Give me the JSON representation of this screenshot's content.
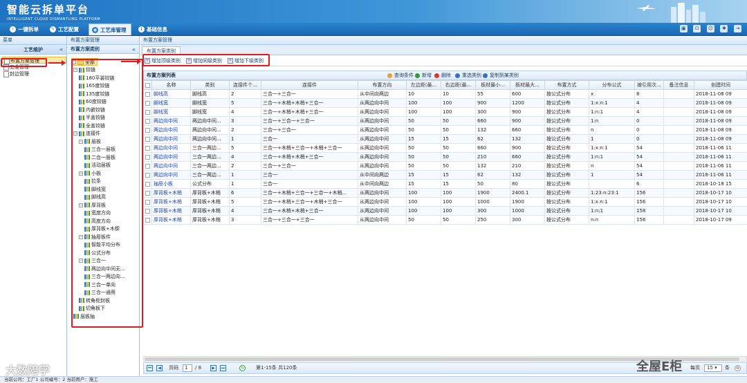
{
  "header": {
    "logo_cn": "智能云拆单平台",
    "logo_en": "INTELLIGENT CLOUD DISMANTLING PLATFORM"
  },
  "nav": {
    "tabs": [
      {
        "label": "一键拆单",
        "icon": "lightning-icon"
      },
      {
        "label": "工艺配置",
        "icon": "wrench-icon"
      },
      {
        "label": "工艺库管理",
        "icon": "library-icon",
        "active": true
      },
      {
        "label": "基础信息",
        "icon": "info-icon"
      }
    ],
    "tools": [
      "print-icon",
      "lock-icon",
      "user-icon",
      "gear-icon",
      "exit-icon"
    ]
  },
  "left": {
    "title": "菜单",
    "subtitle": "工艺维护",
    "items": [
      "布置方案管理",
      "五金管理",
      "封边管理"
    ]
  },
  "mid": {
    "crumb": "布置方案管理",
    "title": "布置方案类别"
  },
  "tree": {
    "root": "全部",
    "nodes": [
      {
        "label": "铰链",
        "level": 1,
        "type": "folder"
      },
      {
        "label": "180平装铰链",
        "level": 2,
        "type": "file"
      },
      {
        "label": "165度铰链",
        "level": 2,
        "type": "file"
      },
      {
        "label": "135度铰链",
        "level": 2,
        "type": "file"
      },
      {
        "label": "60度铰链",
        "level": 2,
        "type": "file"
      },
      {
        "label": "内嵌铰链",
        "level": 2,
        "type": "file"
      },
      {
        "label": "半盖铰链",
        "level": 2,
        "type": "file"
      },
      {
        "label": "全盖铰链",
        "level": 2,
        "type": "file"
      },
      {
        "label": "连接件",
        "level": 1,
        "type": "folder"
      },
      {
        "label": "层板",
        "level": 2,
        "type": "folder"
      },
      {
        "label": "三合一层板",
        "level": 3,
        "type": "file"
      },
      {
        "label": "二合一层板",
        "level": 3,
        "type": "file"
      },
      {
        "label": "活动层板",
        "level": 3,
        "type": "file"
      },
      {
        "label": "小板",
        "level": 2,
        "type": "folder"
      },
      {
        "label": "拉条",
        "level": 3,
        "type": "file"
      },
      {
        "label": "脚线宽",
        "level": 3,
        "type": "file"
      },
      {
        "label": "脚线高",
        "level": 3,
        "type": "file"
      },
      {
        "label": "厚背板",
        "level": 2,
        "type": "folder"
      },
      {
        "label": "宽度方向",
        "level": 3,
        "type": "file"
      },
      {
        "label": "高度方向",
        "level": 3,
        "type": "file"
      },
      {
        "label": "厚背板+木楔",
        "level": 3,
        "type": "file"
      },
      {
        "label": "抽屉板件",
        "level": 2,
        "type": "folder"
      },
      {
        "label": "智能平均分布",
        "level": 3,
        "type": "file"
      },
      {
        "label": "公式分布",
        "level": 3,
        "type": "file"
      },
      {
        "label": "三合一",
        "level": 2,
        "type": "folder"
      },
      {
        "label": "两边向中间无...",
        "level": 3,
        "type": "file"
      },
      {
        "label": "三合一两边向...",
        "level": 3,
        "type": "file"
      },
      {
        "label": "三合一单向",
        "level": 3,
        "type": "file"
      },
      {
        "label": "三合一通用",
        "level": 3,
        "type": "file"
      },
      {
        "label": "转角柜封板",
        "level": 2,
        "type": "file"
      },
      {
        "label": "切角板下",
        "level": 2,
        "type": "file"
      },
      {
        "label": "层板抽",
        "level": 1,
        "type": "file"
      }
    ]
  },
  "main": {
    "crumb": "布置方案管理",
    "tab": "布置方案类别",
    "toolbar": [
      "增加顶级类别",
      "增加同级类别",
      "增加下级类别"
    ],
    "grid_title": "布置方案列表",
    "grid_buttons": [
      {
        "label": "查询条件",
        "icon": "search-icon",
        "color": "#e2a43b"
      },
      {
        "label": "新增",
        "icon": "add-icon",
        "color": "#2e9a3a"
      },
      {
        "label": "删除",
        "icon": "delete-icon",
        "color": "#d23b2a"
      },
      {
        "label": "重选类别",
        "icon": "reselect-icon",
        "color": "#3a6fc0"
      },
      {
        "label": "复制到某类别",
        "icon": "copy-icon",
        "color": "#3a6fc0"
      }
    ],
    "columns": [
      "",
      "名称",
      "类别",
      "连接件个...",
      "连接件",
      "布置方向",
      "左边距(最...",
      "右边距(最...",
      "板材最小...",
      "板材最大...",
      "布置方式",
      "分布公式",
      "被引用次...",
      "备注信息",
      "创建时间"
    ],
    "rows": [
      [
        "脚线高",
        "脚线高",
        "2",
        "三合一+三合一",
        "从中间向两边",
        "10",
        "10",
        "55",
        "600",
        "按公式分布",
        "x",
        "8",
        "",
        "2018-11-08 09"
      ],
      [
        "脚线宽",
        "脚线宽",
        "5",
        "三合一+木梢+木梢+三合一",
        "从两边向中间",
        "100",
        "100",
        "900",
        "1200",
        "按公式分布",
        "1:x:n:1",
        "4",
        "",
        "2018-11-08 09"
      ],
      [
        "脚线宽",
        "脚线宽",
        "4",
        "三合一+木梢+木梢+三合一",
        "从两边向中间",
        "100",
        "100",
        "300",
        "900",
        "按公式分布",
        "1:n:1",
        "4",
        "",
        "2018-11-08 09"
      ],
      [
        "两边向中间",
        "两边向中间...",
        "3",
        "三合一+三合一+三合一",
        "从两边向中间",
        "50",
        "50",
        "660",
        "900",
        "按公式分布",
        "1:n",
        "0",
        "",
        "2018-11-08 09"
      ],
      [
        "两边向中间",
        "两边向中间...",
        "2",
        "三合一+三合一",
        "从两边向中间",
        "50",
        "50",
        "132",
        "660",
        "按公式分布",
        "n",
        "0",
        "",
        "2018-11-08 09"
      ],
      [
        "两边向中间",
        "两边向中间...",
        "1",
        "三合一",
        "从两边向中间",
        "15",
        "15",
        "62",
        "132",
        "按公式分布",
        "1",
        "0",
        "",
        "2018-11-08 09"
      ],
      [
        "两边向中间",
        "三合一两边...",
        "5",
        "三合一+木梢+三合一+木梢+三合一",
        "从两边向中间",
        "50",
        "50",
        "660",
        "900",
        "按公式分布",
        "1:x:n:1",
        "54",
        "",
        "2018-11-06 11"
      ],
      [
        "两边向中间",
        "三合一两边...",
        "4",
        "三合一+木梢+木梢+三合一",
        "从两边向中间",
        "50",
        "50",
        "210",
        "660",
        "按公式分布",
        "1:n:1",
        "54",
        "",
        "2018-11-06 11"
      ],
      [
        "两边向中间",
        "三合一两边...",
        "2",
        "三合一+三合一",
        "从两边向中间",
        "50",
        "50",
        "132",
        "210",
        "按公式分布",
        "n",
        "54",
        "",
        "2018-11-06 11"
      ],
      [
        "两边向中间",
        "三合一两边...",
        "1",
        "三合一",
        "从中间向两边",
        "15",
        "15",
        "62",
        "132",
        "按公式分布",
        "1",
        "54",
        "",
        "2018-11-06 11"
      ],
      [
        "抽屉小板",
        "公式分布",
        "1",
        "三合一",
        "从中间向两边",
        "15",
        "15",
        "50",
        "80",
        "按公式分布",
        "",
        "6",
        "",
        "2018-10-18 15"
      ],
      [
        "厚背板+木梢",
        "厚背板+木梢",
        "6",
        "三合一+木梢+三合一+三合一+木梢...",
        "从两边向中间",
        "100",
        "100",
        "1900",
        "2400.1",
        "按公式分布",
        "1:23:n:23:1",
        "156",
        "",
        "2018-10-17 10"
      ],
      [
        "厚背板+木梢",
        "厚背板+木梢",
        "5",
        "三合一+木梢+三合一+木梢+三合一",
        "从两边向中间",
        "100",
        "100",
        "1000",
        "1900",
        "按公式分布",
        "1:x:n:1",
        "156",
        "",
        "2018-10-17 10"
      ],
      [
        "厚背板+木梢",
        "厚背板+木梢",
        "4",
        "三合一+木梢+木梢+三合一",
        "从两边向中间",
        "100",
        "100",
        "300",
        "1000",
        "按公式分布",
        "1:n:1",
        "158",
        "",
        "2018-10-17 10"
      ],
      [
        "厚背板+木梢",
        "厚背板+木梢",
        "3",
        "三合一+三合一+三合一",
        "从两边向中间",
        "50",
        "50",
        "250",
        "300",
        "按公式分布",
        "n:n",
        "156",
        "",
        "2018-10-17 09"
      ]
    ],
    "pager": {
      "page_label": "页码",
      "page": "1",
      "total_pages": "/ 8",
      "summary": "第1-15条  共120条",
      "per_page_label": "每页",
      "per_page": "15",
      "per_page_unit": "条"
    }
  },
  "footer": "当前公司：工厂1   公司编号：2   当前用户：施工",
  "watermarks": [
    "大数陪学",
    "全屋E柜"
  ]
}
